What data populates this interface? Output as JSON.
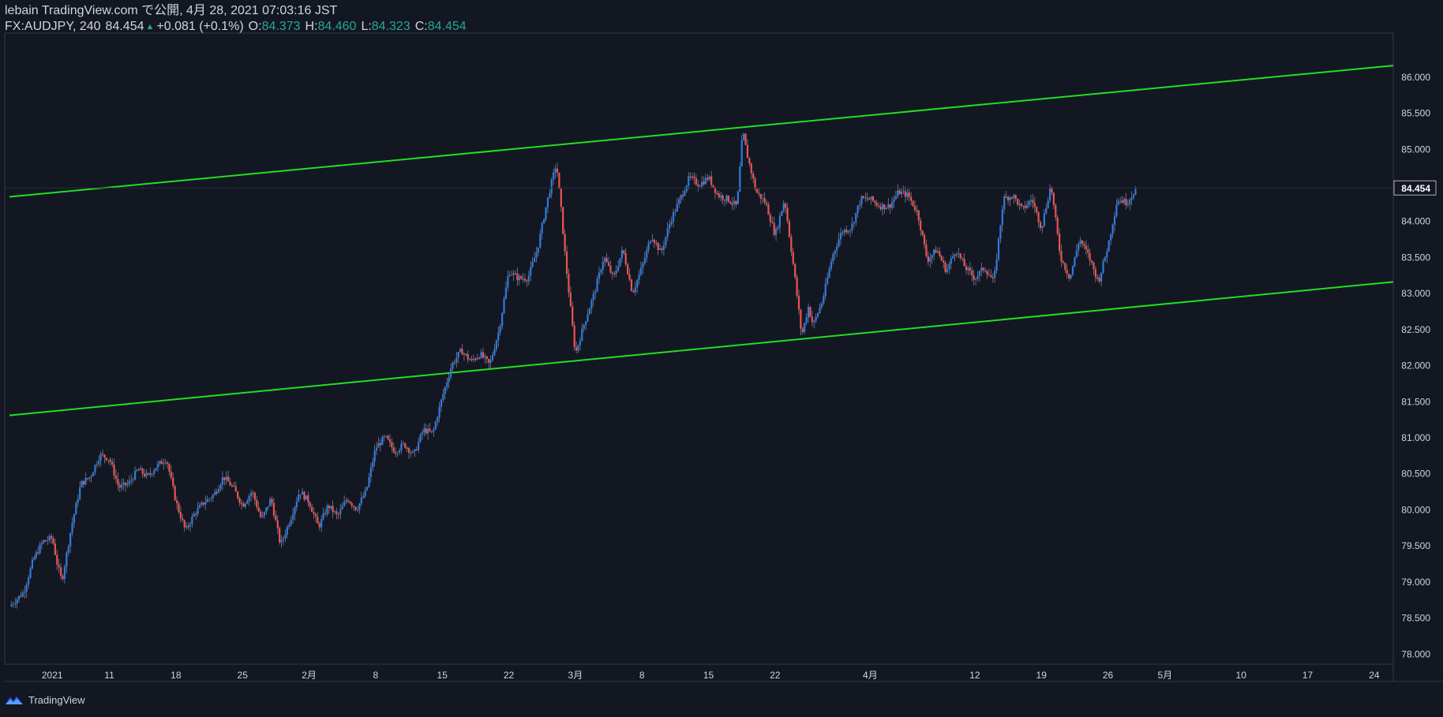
{
  "header": {
    "published": "lebain TradingView.com で公開, 4月 28, 2021 07:03:16 JST",
    "symbol": "FX:AUDJPY, 240",
    "last": "84.454",
    "change": "+0.081 (+0.1%)",
    "o_label": "O:",
    "o_value": "84.373",
    "h_label": "H:",
    "h_value": "84.460",
    "l_label": "L:",
    "l_value": "84.323",
    "c_label": "C:",
    "c_value": "84.454"
  },
  "footer": {
    "brand": "TradingView"
  },
  "colors": {
    "background": "#131722",
    "up": "#2a7de1",
    "down": "#ef5350",
    "trendline": "#1fe01f",
    "text": "#d1d4dc",
    "accent": "#26a69a"
  },
  "chart_data": {
    "type": "line",
    "ylim": [
      77.85,
      86.6
    ],
    "y_ticks": [
      78.0,
      78.5,
      79.0,
      79.5,
      80.0,
      80.5,
      81.0,
      81.5,
      82.0,
      82.5,
      83.0,
      83.5,
      84.0,
      84.5,
      85.0,
      85.5,
      86.0
    ],
    "y_tick_labels": [
      "78.000",
      "78.500",
      "79.000",
      "79.500",
      "80.000",
      "80.500",
      "81.000",
      "81.500",
      "82.000",
      "82.500",
      "83.000",
      "83.500",
      "84.000",
      "84.500",
      "85.000",
      "85.500",
      "86.000"
    ],
    "x_ticks": [
      {
        "label": "2021",
        "day": 5
      },
      {
        "label": "11",
        "day": 11
      },
      {
        "label": "18",
        "day": 18
      },
      {
        "label": "25",
        "day": 25
      },
      {
        "label": "2月",
        "day": 32
      },
      {
        "label": "8",
        "day": 39
      },
      {
        "label": "15",
        "day": 46
      },
      {
        "label": "22",
        "day": 53
      },
      {
        "label": "3月",
        "day": 60
      },
      {
        "label": "8",
        "day": 67
      },
      {
        "label": "15",
        "day": 74
      },
      {
        "label": "22",
        "day": 81
      },
      {
        "label": "4月",
        "day": 91
      },
      {
        "label": "12",
        "day": 102
      },
      {
        "label": "19",
        "day": 109
      },
      {
        "label": "26",
        "day": 116
      },
      {
        "label": "5月",
        "day": 122
      },
      {
        "label": "10",
        "day": 130
      },
      {
        "label": "17",
        "day": 137
      },
      {
        "label": "24",
        "day": 144
      }
    ],
    "last_price": 84.454,
    "last_price_label": "84.454",
    "trendlines": [
      {
        "x1": 0.5,
        "y1": 84.33,
        "x2": 146,
        "y2": 86.15
      },
      {
        "x1": 0.5,
        "y1": 81.3,
        "x2": 146,
        "y2": 83.15
      }
    ],
    "price_path": [
      [
        0.5,
        78.65
      ],
      [
        2,
        78.85
      ],
      [
        3,
        79.3
      ],
      [
        4,
        79.55
      ],
      [
        5,
        79.6
      ],
      [
        5.5,
        79.25
      ],
      [
        6,
        79.0
      ],
      [
        7,
        79.75
      ],
      [
        8,
        80.35
      ],
      [
        9,
        80.45
      ],
      [
        10,
        80.75
      ],
      [
        11,
        80.7
      ],
      [
        12,
        80.3
      ],
      [
        13,
        80.35
      ],
      [
        14,
        80.55
      ],
      [
        15,
        80.45
      ],
      [
        16,
        80.6
      ],
      [
        17,
        80.7
      ],
      [
        18,
        80.1
      ],
      [
        19,
        79.7
      ],
      [
        20,
        79.95
      ],
      [
        21,
        80.1
      ],
      [
        22,
        80.2
      ],
      [
        23,
        80.45
      ],
      [
        24,
        80.3
      ],
      [
        25,
        80.05
      ],
      [
        26,
        80.25
      ],
      [
        27,
        79.85
      ],
      [
        28,
        80.15
      ],
      [
        29,
        79.5
      ],
      [
        30,
        79.85
      ],
      [
        31,
        80.25
      ],
      [
        32,
        80.1
      ],
      [
        33,
        79.75
      ],
      [
        34,
        80.05
      ],
      [
        35,
        79.9
      ],
      [
        36,
        80.15
      ],
      [
        37,
        80.0
      ],
      [
        38,
        80.25
      ],
      [
        39,
        80.85
      ],
      [
        40,
        81.0
      ],
      [
        41,
        80.8
      ],
      [
        42,
        80.9
      ],
      [
        43,
        80.75
      ],
      [
        44,
        81.1
      ],
      [
        45,
        81.05
      ],
      [
        46,
        81.55
      ],
      [
        47,
        82.0
      ],
      [
        48,
        82.2
      ],
      [
        49,
        82.05
      ],
      [
        50,
        82.15
      ],
      [
        51,
        82.0
      ],
      [
        52,
        82.5
      ],
      [
        53,
        83.3
      ],
      [
        54,
        83.2
      ],
      [
        55,
        83.2
      ],
      [
        56,
        83.6
      ],
      [
        57,
        84.25
      ],
      [
        58,
        84.8
      ],
      [
        58.5,
        84.15
      ],
      [
        59,
        83.4
      ],
      [
        60,
        82.15
      ],
      [
        61,
        82.6
      ],
      [
        62,
        83.0
      ],
      [
        63,
        83.5
      ],
      [
        64,
        83.2
      ],
      [
        65,
        83.6
      ],
      [
        66,
        83.0
      ],
      [
        67,
        83.35
      ],
      [
        68,
        83.8
      ],
      [
        69,
        83.55
      ],
      [
        70,
        84.0
      ],
      [
        71,
        84.3
      ],
      [
        72,
        84.6
      ],
      [
        73,
        84.5
      ],
      [
        74,
        84.6
      ],
      [
        75,
        84.35
      ],
      [
        76,
        84.3
      ],
      [
        77,
        84.2
      ],
      [
        77.6,
        85.25
      ],
      [
        78,
        84.95
      ],
      [
        79,
        84.4
      ],
      [
        80,
        84.25
      ],
      [
        81,
        83.8
      ],
      [
        82,
        84.3
      ],
      [
        83,
        83.3
      ],
      [
        83.8,
        82.4
      ],
      [
        84.5,
        82.8
      ],
      [
        85,
        82.55
      ],
      [
        86,
        82.9
      ],
      [
        87,
        83.5
      ],
      [
        88,
        83.85
      ],
      [
        89,
        83.9
      ],
      [
        90,
        84.3
      ],
      [
        91,
        84.3
      ],
      [
        92,
        84.2
      ],
      [
        93,
        84.2
      ],
      [
        94,
        84.4
      ],
      [
        95,
        84.35
      ],
      [
        96,
        84.1
      ],
      [
        97,
        83.45
      ],
      [
        98,
        83.6
      ],
      [
        99,
        83.3
      ],
      [
        100,
        83.6
      ],
      [
        101,
        83.35
      ],
      [
        102,
        83.2
      ],
      [
        103,
        83.35
      ],
      [
        104,
        83.15
      ],
      [
        105,
        84.3
      ],
      [
        106,
        84.35
      ],
      [
        107,
        84.15
      ],
      [
        108,
        84.3
      ],
      [
        109,
        83.9
      ],
      [
        110,
        84.5
      ],
      [
        111,
        83.5
      ],
      [
        112,
        83.2
      ],
      [
        113,
        83.75
      ],
      [
        114,
        83.5
      ],
      [
        115,
        83.15
      ],
      [
        116,
        83.65
      ],
      [
        117,
        84.3
      ],
      [
        118,
        84.25
      ],
      [
        119,
        84.454
      ]
    ]
  }
}
